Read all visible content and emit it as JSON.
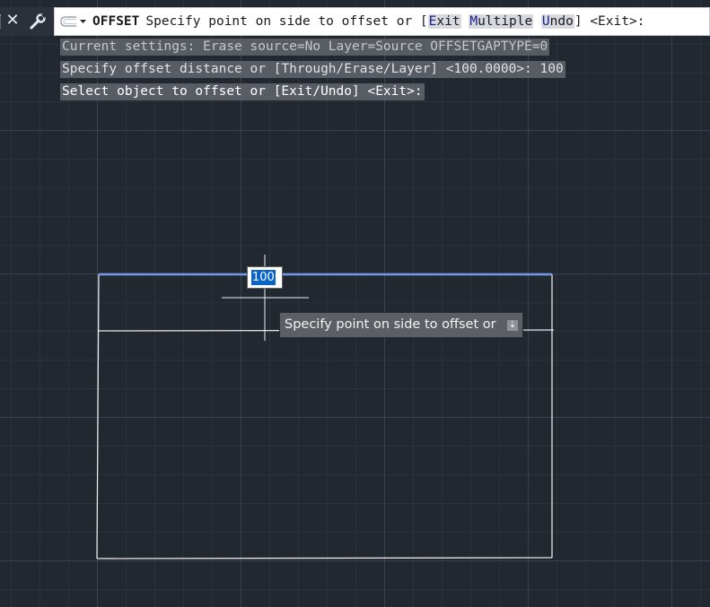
{
  "command_line": {
    "command_name": "OFFSET",
    "prompt_text": "Specify point on side to offset or [",
    "options": [
      {
        "hotkey": "E",
        "rest": "xit"
      },
      {
        "hotkey": "M",
        "rest": "ultiple"
      },
      {
        "hotkey": "U",
        "rest": "ndo"
      }
    ],
    "prompt_suffix": "] <Exit>:"
  },
  "history": [
    "Current settings: Erase source=No  Layer=Source  OFFSETGAPTYPE=0",
    "Specify offset distance or [Through/Erase/Layer] <100.0000>: 100",
    "Select object to offset or [Exit/Undo] <Exit>:"
  ],
  "dynamic_input": {
    "value": "100",
    "tooltip": "Specify point on side to offset or"
  },
  "colors": {
    "canvas_background": "#212830",
    "selected_line": "#5a8ff0",
    "geometry": "#e6e6e6",
    "option_highlight": "#d6d9de",
    "option_hotkey": "#1b1f8c"
  },
  "icons": {
    "close": "close-icon",
    "customize": "wrench-icon",
    "recent_commands": "command-history-icon"
  }
}
